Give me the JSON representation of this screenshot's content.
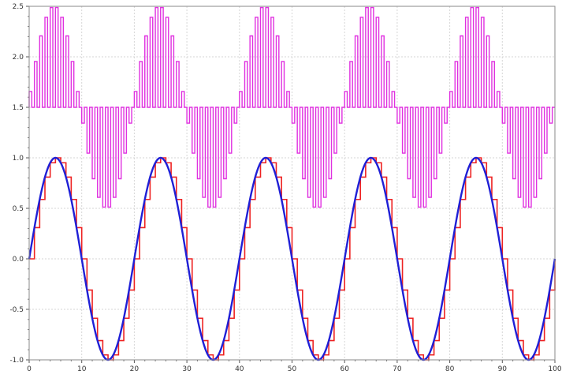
{
  "chart_data": {
    "type": "line",
    "title": "",
    "xlabel": "",
    "ylabel": "",
    "xlim": [
      0,
      100
    ],
    "ylim": [
      -1.0,
      2.5
    ],
    "grid": true,
    "legend": "none",
    "x_ticks": [
      0,
      10,
      20,
      30,
      40,
      50,
      60,
      70,
      80,
      90,
      100
    ],
    "x_tick_labels": [
      "0",
      "10",
      "20",
      "30",
      "40",
      "50",
      "60",
      "70",
      "80",
      "90",
      "100"
    ],
    "y_ticks": [
      -1.0,
      -0.5,
      0.0,
      0.5,
      1.0,
      1.5,
      2.0,
      2.5
    ],
    "y_tick_labels": [
      "-1.0",
      "-0.5",
      "0.0",
      "0.5",
      "1.0",
      "1.5",
      "2.0",
      "2.5"
    ],
    "series": [
      {
        "kind": "sine",
        "color": "#1f1fd6",
        "period": 20,
        "amplitude": 1.0,
        "offset": 0.0,
        "x_range": [
          0,
          100
        ]
      },
      {
        "kind": "sampled_step",
        "color": "#ee2222",
        "period": 20,
        "amplitude": 1.0,
        "offset": 0.0,
        "sample_interval": 1,
        "x_range": [
          0,
          100
        ]
      },
      {
        "kind": "pwm_modulated",
        "color": "#e030e0",
        "period": 20,
        "amplitude": 1.0,
        "baseline": 1.5,
        "carrier_interval": 1,
        "x_range": [
          0,
          100
        ]
      }
    ]
  }
}
